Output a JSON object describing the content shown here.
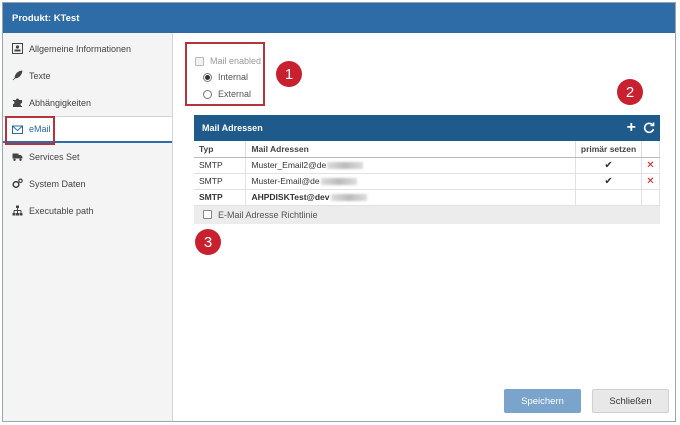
{
  "window": {
    "title": "Produkt: KTest"
  },
  "sidebar": {
    "items": [
      {
        "label": "Allgemeine Informationen",
        "icon": "id-card-icon"
      },
      {
        "label": "Texte",
        "icon": "feather-icon"
      },
      {
        "label": "Abhängigkeiten",
        "icon": "puzzle-icon"
      },
      {
        "label": "eMail",
        "icon": "envelope-icon",
        "active": true
      },
      {
        "label": "Services Set",
        "icon": "truck-icon"
      },
      {
        "label": "System Daten",
        "icon": "gears-icon"
      },
      {
        "label": "Executable path",
        "icon": "sitemap-icon"
      }
    ]
  },
  "mail_settings": {
    "enabled_label": "Mail enabled",
    "internal_label": "Internal",
    "external_label": "External",
    "selected": "Internal"
  },
  "badges": [
    "1",
    "2",
    "3"
  ],
  "mail_table": {
    "title": "Mail Adressen",
    "columns": [
      "Typ",
      "Mail Adressen",
      "primär setzen",
      ""
    ],
    "rows": [
      {
        "type": "SMTP",
        "address": "Muster_Email2@de",
        "primary": "✔",
        "delete": "✕"
      },
      {
        "type": "SMTP",
        "address": "Muster-Email@de",
        "primary": "✔",
        "delete": "✕"
      },
      {
        "type": "SMTP",
        "address": "AHPDISKTest@dev",
        "primary": "",
        "delete": ""
      }
    ],
    "policy_label": "E-Mail Adresse Richtlinie"
  },
  "buttons": {
    "save": "Speichern",
    "close": "Schließen"
  },
  "colors": {
    "header": "#2d6ca6",
    "table_header": "#1f5a8c",
    "badge": "#c8202f",
    "highlight": "#b4343d"
  }
}
